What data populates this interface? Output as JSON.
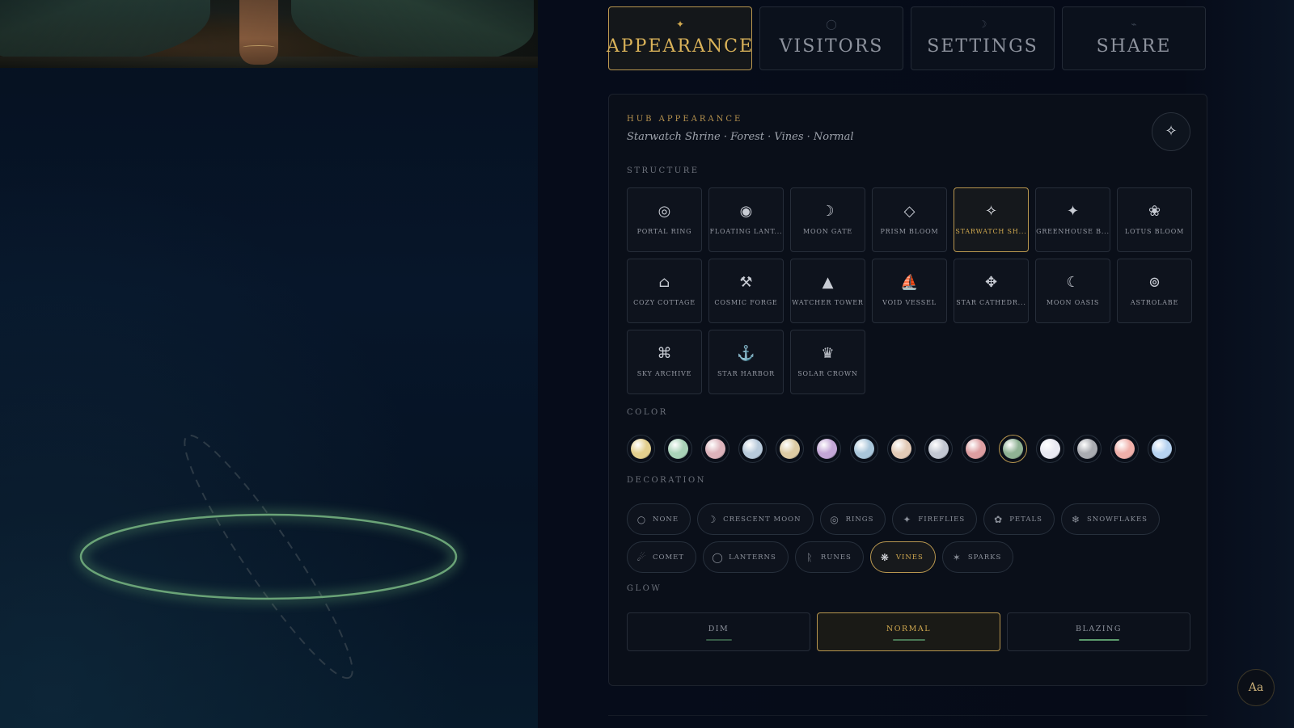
{
  "tabs": [
    {
      "id": "appearance",
      "label": "APPEARANCE",
      "icon": "✦",
      "active": true
    },
    {
      "id": "visitors",
      "label": "VISITORS",
      "icon": "◯",
      "active": false
    },
    {
      "id": "settings",
      "label": "SETTINGS",
      "icon": "☽",
      "active": false
    },
    {
      "id": "share",
      "label": "SHARE",
      "icon": "⌁",
      "active": false
    }
  ],
  "hub": {
    "title": "HUB APPEARANCE",
    "subtitle": "Starwatch Shrine · Forest · Vines · Normal",
    "magic_icon": "✧"
  },
  "sections": {
    "structure": "STRUCTURE",
    "color": "COLOR",
    "decoration": "DECORATION",
    "glow": "GLOW"
  },
  "structures": [
    {
      "label": "PORTAL RING",
      "icon": "◎",
      "active": false
    },
    {
      "label": "FLOATING LANT...",
      "icon": "◉",
      "active": false
    },
    {
      "label": "MOON GATE",
      "icon": "☽",
      "active": false
    },
    {
      "label": "PRISM BLOOM",
      "icon": "◇",
      "active": false
    },
    {
      "label": "STARWATCH SH...",
      "icon": "✧",
      "active": true
    },
    {
      "label": "GREENHOUSE B...",
      "icon": "✦",
      "active": false
    },
    {
      "label": "LOTUS BLOOM",
      "icon": "❀",
      "active": false
    },
    {
      "label": "COZY COTTAGE",
      "icon": "⌂",
      "active": false
    },
    {
      "label": "COSMIC FORGE",
      "icon": "⚒",
      "active": false
    },
    {
      "label": "WATCHER TOWER",
      "icon": "▲",
      "active": false
    },
    {
      "label": "VOID VESSEL",
      "icon": "⛵",
      "active": false
    },
    {
      "label": "STAR CATHEDR...",
      "icon": "✥",
      "active": false
    },
    {
      "label": "MOON OASIS",
      "icon": "☾",
      "active": false
    },
    {
      "label": "ASTROLABE",
      "icon": "⊚",
      "active": false
    },
    {
      "label": "SKY ARCHIVE",
      "icon": "⌘",
      "active": false
    },
    {
      "label": "STAR HARBOR",
      "icon": "⚓",
      "active": false
    },
    {
      "label": "SOLAR CROWN",
      "icon": "♛",
      "active": false
    }
  ],
  "colors": [
    {
      "hex": "#e3cf8e",
      "active": false
    },
    {
      "hex": "#a9d2b8",
      "active": false
    },
    {
      "hex": "#dcb3bb",
      "active": false
    },
    {
      "hex": "#b8cadb",
      "active": false
    },
    {
      "hex": "#ddcba4",
      "active": false
    },
    {
      "hex": "#c3a6d6",
      "active": false
    },
    {
      "hex": "#a9c6da",
      "active": false
    },
    {
      "hex": "#e2cab6",
      "active": false
    },
    {
      "hex": "#c2c7d2",
      "active": false
    },
    {
      "hex": "#dd9ea1",
      "active": false
    },
    {
      "hex": "#8fb294",
      "active": true
    },
    {
      "hex": "#e9e9f2",
      "active": false
    },
    {
      "hex": "#a9abb1",
      "active": false
    },
    {
      "hex": "#f0b0aa",
      "active": false
    },
    {
      "hex": "#b6d2f0",
      "active": false
    }
  ],
  "decorations": [
    {
      "label": "NONE",
      "icon": "○",
      "active": false
    },
    {
      "label": "CRESCENT MOON",
      "icon": "☽",
      "active": false
    },
    {
      "label": "RINGS",
      "icon": "◎",
      "active": false
    },
    {
      "label": "FIREFLIES",
      "icon": "✦",
      "active": false
    },
    {
      "label": "PETALS",
      "icon": "✿",
      "active": false
    },
    {
      "label": "SNOWFLAKES",
      "icon": "❄",
      "active": false
    },
    {
      "label": "COMET",
      "icon": "☄",
      "active": false
    },
    {
      "label": "LANTERNS",
      "icon": "◯",
      "active": false
    },
    {
      "label": "RUNES",
      "icon": "ᚱ",
      "active": false
    },
    {
      "label": "VINES",
      "icon": "❋",
      "active": true
    },
    {
      "label": "SPARKS",
      "icon": "✶",
      "active": false
    }
  ],
  "glow_options": [
    {
      "label": "DIM",
      "level": 0.3,
      "active": false
    },
    {
      "label": "NORMAL",
      "level": 0.6,
      "active": true
    },
    {
      "label": "BLAZING",
      "level": 1.0,
      "active": false
    }
  ],
  "font_button": "Aa",
  "accent": "#d0a84f",
  "glow_color": "#5b9a6c"
}
